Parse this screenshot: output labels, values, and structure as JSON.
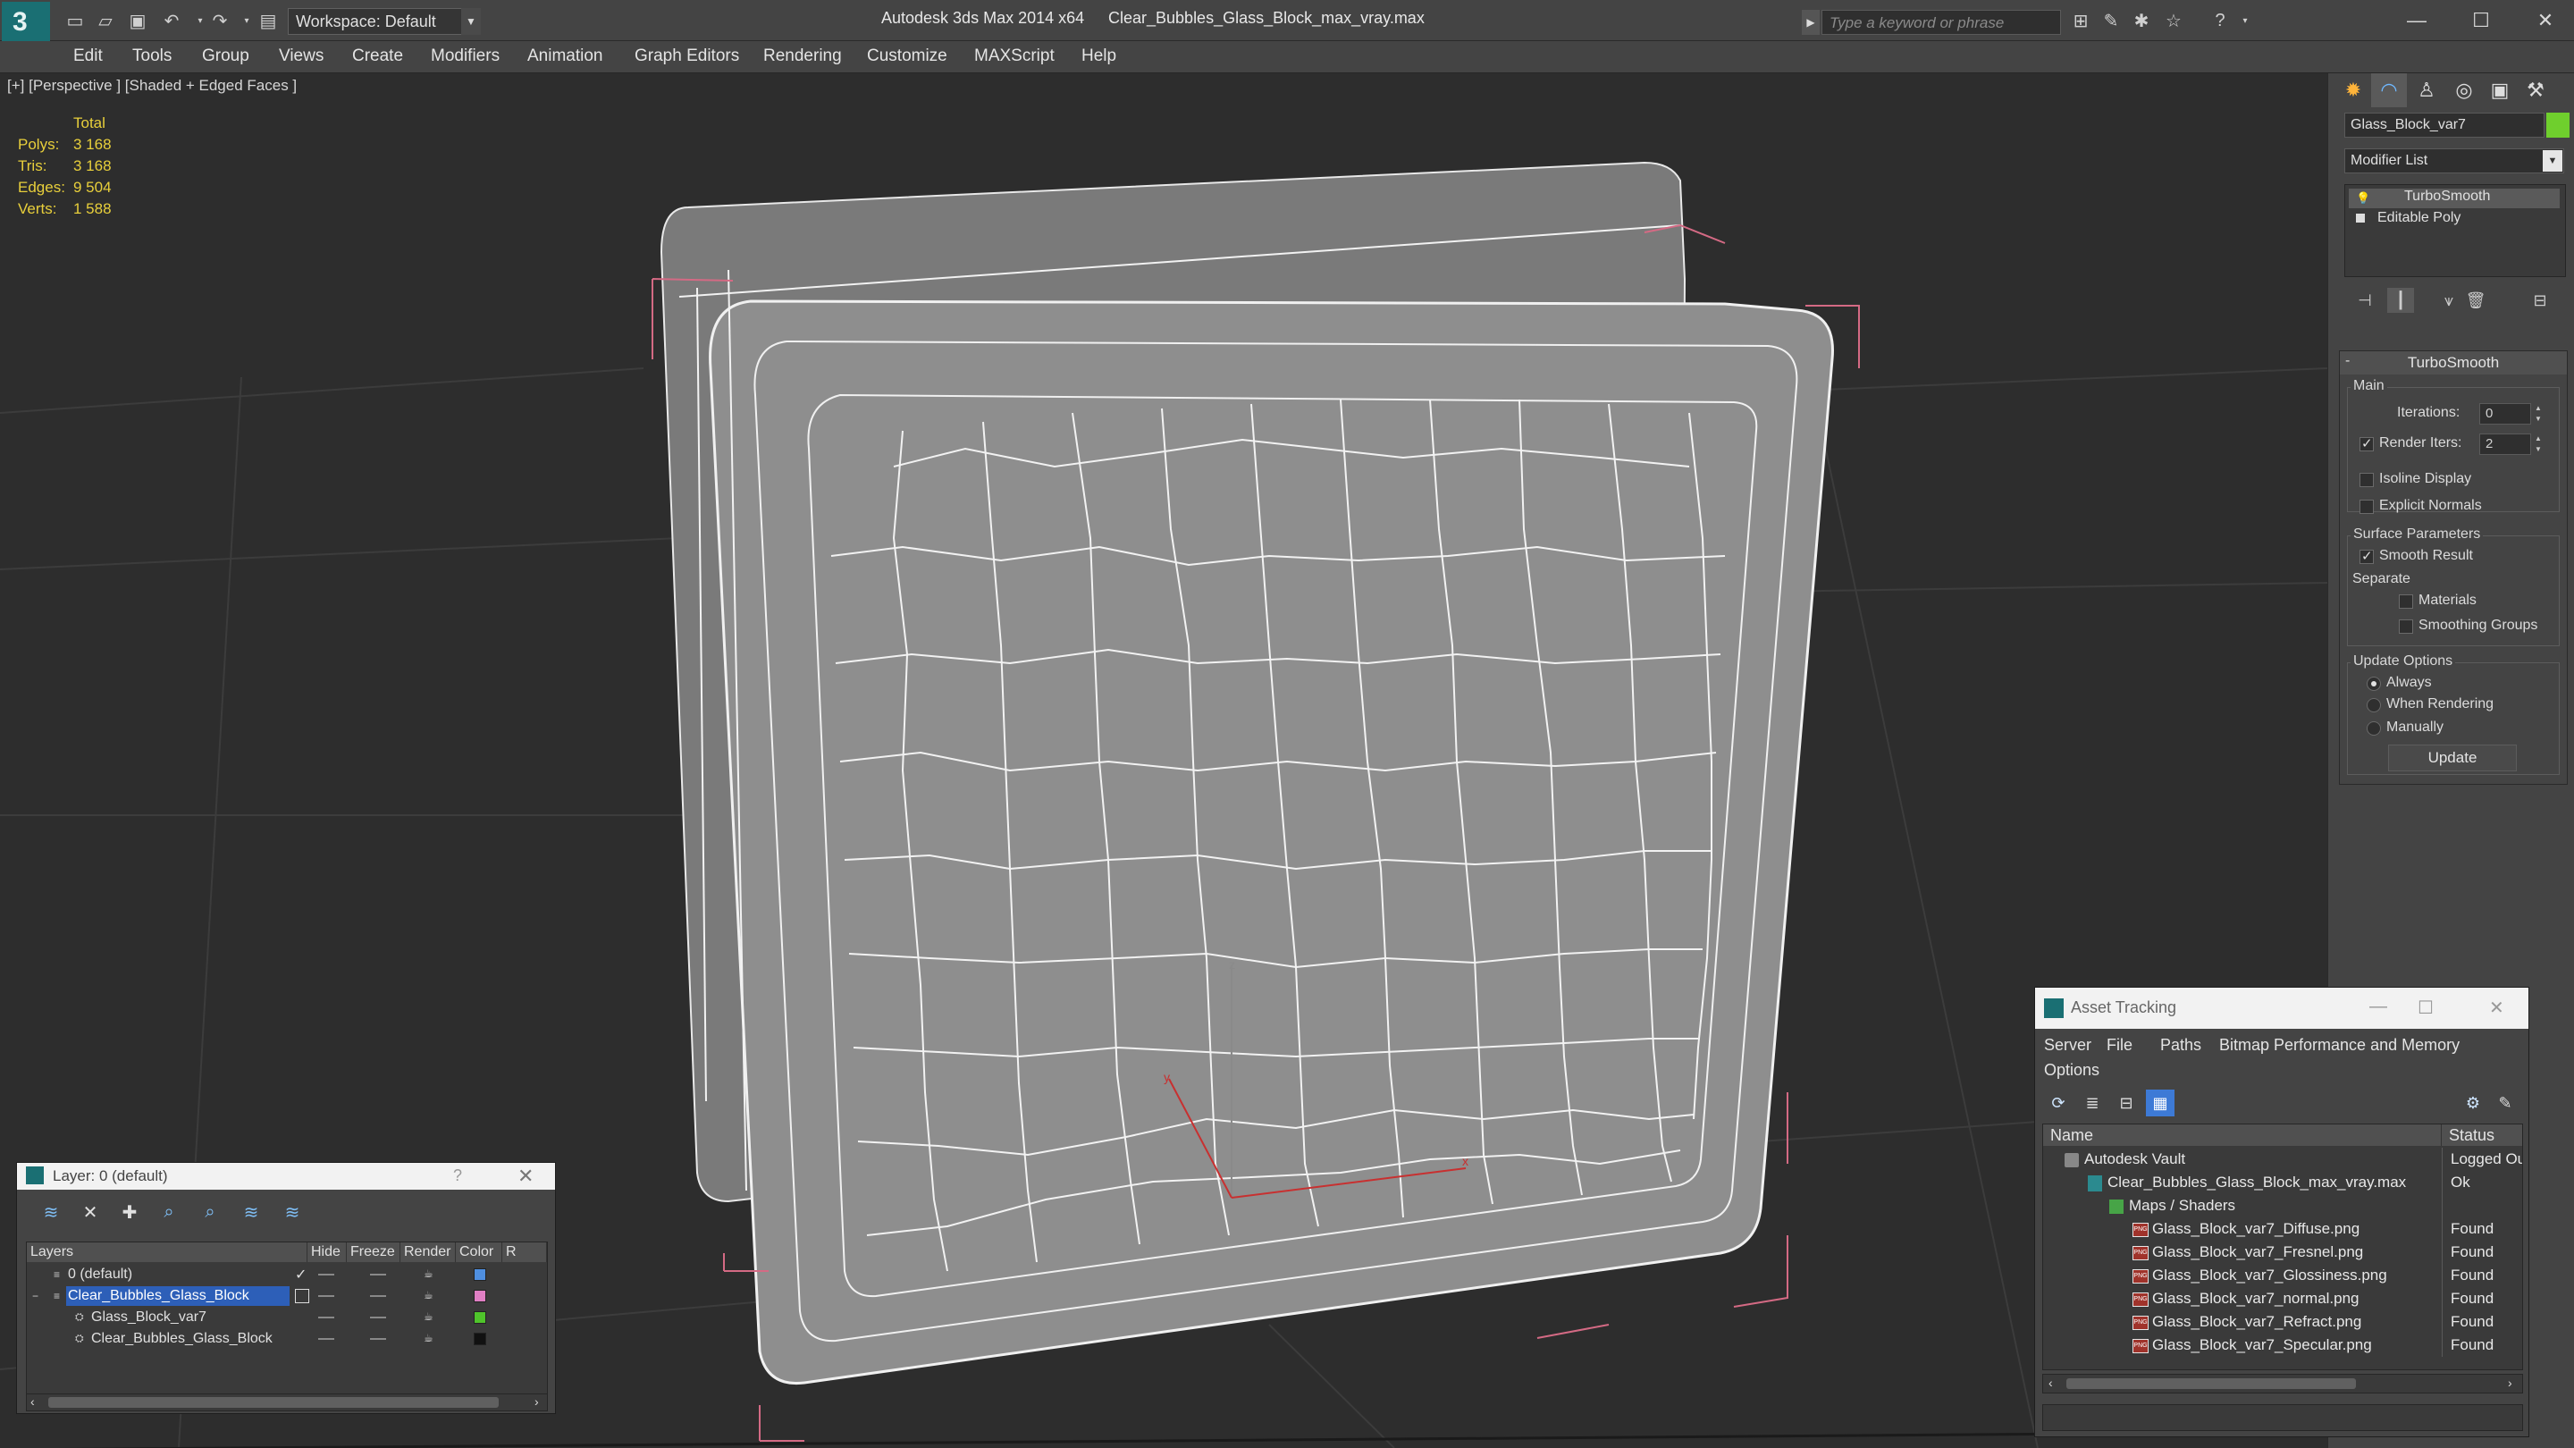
{
  "titlebar": {
    "workspace": "Workspace: Default",
    "app_title": "Autodesk 3ds Max  2014 x64",
    "file_title": "Clear_Bubbles_Glass_Block_max_vray.max",
    "search_placeholder": "Type a keyword or phrase"
  },
  "menu": [
    "Edit",
    "Tools",
    "Group",
    "Views",
    "Create",
    "Modifiers",
    "Animation",
    "Graph Editors",
    "Rendering",
    "Customize",
    "MAXScript",
    "Help"
  ],
  "viewport": {
    "label": "[+] [Perspective ] [Shaded + Edged Faces ]",
    "stats": {
      "header": "Total",
      "polys_label": "Polys:",
      "polys": "3 168",
      "tris_label": "Tris:",
      "tris": "3 168",
      "edges_label": "Edges:",
      "edges": "9 504",
      "verts_label": "Verts:",
      "verts": "1 588"
    },
    "axis_labels": {
      "z": "z",
      "y": "y",
      "x": "x"
    }
  },
  "command_panel": {
    "object_name": "Glass_Block_var7",
    "object_color": "#6fcf2d",
    "modifier_list": "Modifier List",
    "stack": [
      "TurboSmooth",
      "Editable Poly"
    ],
    "rollout_title": "TurboSmooth",
    "main_label": "Main",
    "iterations_label": "Iterations:",
    "iterations": "0",
    "render_iters_label": "Render Iters:",
    "render_iters": "2",
    "render_iters_checked": true,
    "isoline_label": "Isoline Display",
    "explicit_normals_label": "Explicit Normals",
    "surface_params_label": "Surface Parameters",
    "smooth_result_label": "Smooth Result",
    "separate_label": "Separate",
    "materials_label": "Materials",
    "smoothing_groups_label": "Smoothing Groups",
    "update_options_label": "Update Options",
    "always_label": "Always",
    "when_rendering_label": "When Rendering",
    "manually_label": "Manually",
    "update_button": "Update"
  },
  "layer_panel": {
    "title": "Layer: 0 (default)",
    "help": "?",
    "columns": [
      "Layers",
      "Hide",
      "Freeze",
      "Render",
      "Color",
      "R"
    ],
    "rows": [
      {
        "name": "0 (default)",
        "color": "#4f8fe0"
      },
      {
        "name": "Clear_Bubbles_Glass_Block",
        "color": "#e07fc4"
      },
      {
        "name": "Glass_Block_var7",
        "color": "#4fc42b"
      },
      {
        "name": "Clear_Bubbles_Glass_Block",
        "color": "#111111"
      }
    ]
  },
  "asset_panel": {
    "title": "Asset Tracking",
    "menu": [
      "Server",
      "File",
      "Paths",
      "Bitmap Performance and Memory",
      "Options"
    ],
    "columns": [
      "Name",
      "Status"
    ],
    "rows": [
      {
        "name": "Autodesk Vault",
        "status": "Logged Ou",
        "icon": "vault-icon"
      },
      {
        "name": "Clear_Bubbles_Glass_Block_max_vray.max",
        "status": "Ok",
        "icon": "max-file-icon"
      },
      {
        "name": "Maps / Shaders",
        "status": "",
        "icon": "maps-folder-icon"
      },
      {
        "name": "Glass_Block_var7_Diffuse.png",
        "status": "Found",
        "icon": "png-file-icon"
      },
      {
        "name": "Glass_Block_var7_Fresnel.png",
        "status": "Found",
        "icon": "png-file-icon"
      },
      {
        "name": "Glass_Block_var7_Glossiness.png",
        "status": "Found",
        "icon": "png-file-icon"
      },
      {
        "name": "Glass_Block_var7_normal.png",
        "status": "Found",
        "icon": "png-file-icon"
      },
      {
        "name": "Glass_Block_var7_Refract.png",
        "status": "Found",
        "icon": "png-file-icon"
      },
      {
        "name": "Glass_Block_var7_Specular.png",
        "status": "Found",
        "icon": "png-file-icon"
      }
    ]
  }
}
